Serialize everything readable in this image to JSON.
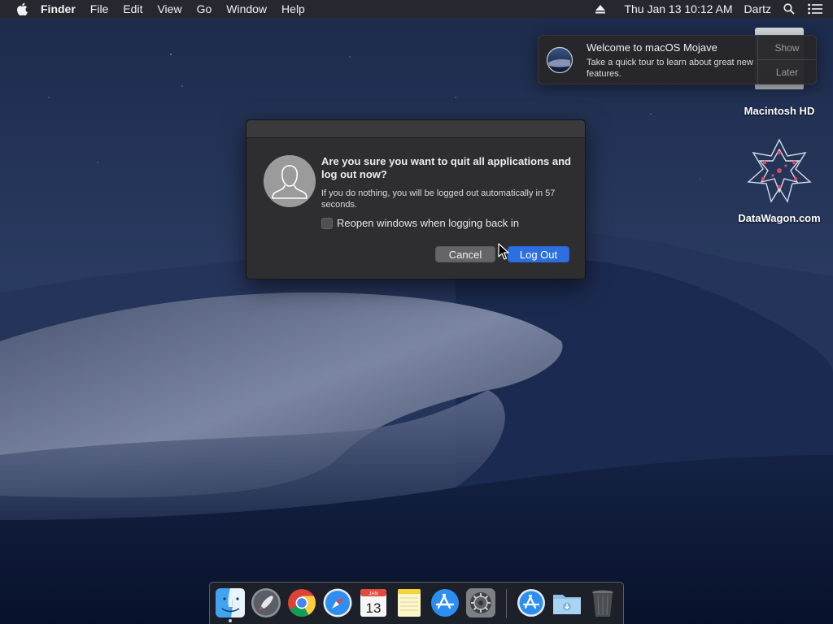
{
  "menubar": {
    "apple_icon": "apple-icon",
    "app_name": "Finder",
    "menus": [
      "File",
      "Edit",
      "View",
      "Go",
      "Window",
      "Help"
    ],
    "clock": "Thu Jan 13  10:12 AM",
    "user": "Dartz",
    "status_icons": [
      "eject-icon",
      "spotlight-search-icon",
      "notification-center-icon"
    ]
  },
  "desktop": {
    "icons": [
      {
        "label": "Macintosh HD",
        "icon": "hard-drive-icon"
      },
      {
        "label": "DataWagon.com",
        "icon": "datawagon-logo-icon"
      }
    ]
  },
  "notification": {
    "title": "Welcome to macOS Mojave",
    "text": "Take a quick tour to learn about great new features.",
    "show_label": "Show",
    "later_label": "Later",
    "icon": "mojave-icon"
  },
  "dialog": {
    "title": "Are you sure you want to quit all applications and log out now?",
    "body": "If you do nothing, you will be logged out automatically in 57 seconds.",
    "checkbox_label": "Reopen windows when logging back in",
    "checkbox_checked": false,
    "cancel_label": "Cancel",
    "logout_label": "Log Out",
    "avatar_icon": "user-avatar-icon"
  },
  "dock": {
    "items": [
      {
        "name": "Finder",
        "icon": "finder-icon",
        "running": true
      },
      {
        "name": "Launchpad",
        "icon": "launchpad-icon",
        "running": false
      },
      {
        "name": "Google Chrome",
        "icon": "chrome-icon",
        "running": false
      },
      {
        "name": "Safari",
        "icon": "safari-icon",
        "running": false
      },
      {
        "name": "Calendar",
        "icon": "calendar-icon",
        "running": false,
        "month": "JAN",
        "day": "13"
      },
      {
        "name": "Notes",
        "icon": "notes-icon",
        "running": false
      },
      {
        "name": "App Store",
        "icon": "app-store-icon",
        "running": false
      },
      {
        "name": "System Preferences",
        "icon": "system-preferences-icon",
        "running": false
      },
      {
        "name": "Applications",
        "icon": "applications-folder-icon",
        "running": false
      },
      {
        "name": "Downloads",
        "icon": "downloads-folder-icon",
        "running": false
      },
      {
        "name": "Trash",
        "icon": "trash-icon",
        "running": false
      }
    ]
  },
  "colors": {
    "accent_blue": "#2c6fe0",
    "dialog_bg": "#2e2e30",
    "menubar_bg": "#28282c"
  }
}
